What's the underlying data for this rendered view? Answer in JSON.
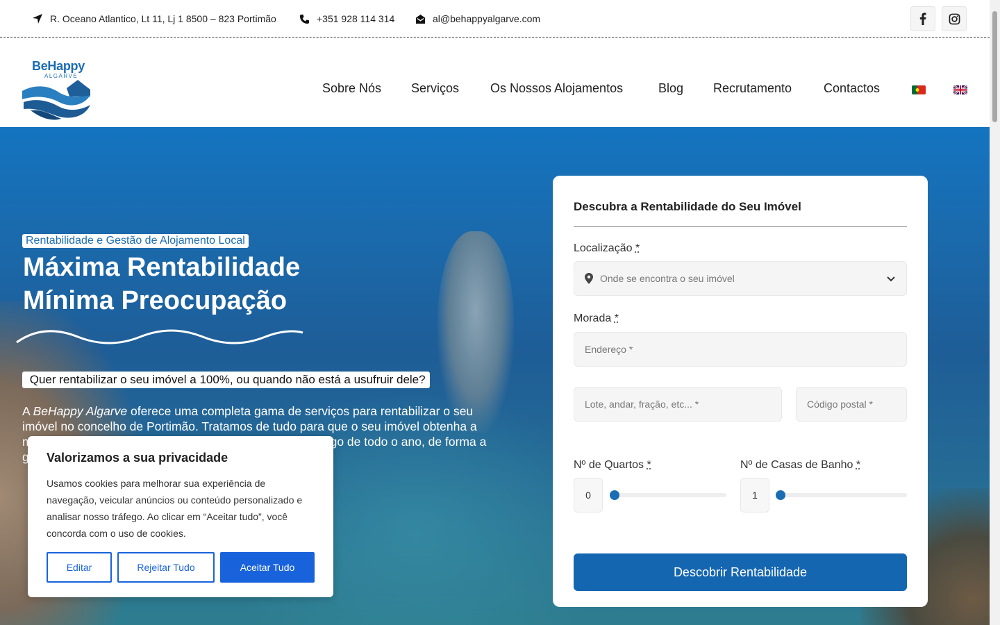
{
  "topbar": {
    "address": "R. Oceano Atlantico, Lt 11, Lj 1 8500 – 823 Portimão",
    "phone": "+351 928 114 314",
    "email": "al@behappyalgarve.com"
  },
  "logo": {
    "brand": "BeHappy",
    "sub": "ALGARVE"
  },
  "nav": {
    "items": [
      "Sobre Nós",
      "Serviços",
      "Os Nossos Alojamentos",
      "Blog",
      "Recrutamento",
      "Contactos"
    ]
  },
  "hero": {
    "tagline": "Rentabilidade e Gestão de Alojamento Local",
    "headline_line1": "Máxima Rentabilidade",
    "headline_line2": "Mínima Preocupação",
    "question": "󠁧󠁢 Quer rentabilizar o seu imóvel a 100%, ou quando não está a usufruir dele?",
    "para_prefix": "A ",
    "para_brand": "BeHappy Algarve",
    "para_text": " oferece uma completa gama de serviços para rentabilizar o seu imóvel no concelho de Portimão. Tratamos de tudo para que o seu imóvel obtenha a máxima rentabilidade, com uma taxa de ocupação ao longo de todo o ano, de forma a garantir o máximo de retorno."
  },
  "form": {
    "title": "Descubra a Rentabilidade do Seu Imóvel",
    "location_label": "Localização",
    "location_placeholder": "Onde se encontra o seu imóvel",
    "address_label": "Morada",
    "address_placeholder": "Endereço *",
    "lot_placeholder": "Lote, andar, fração, etc... *",
    "postal_placeholder": "Código postal *",
    "rooms_label": "Nº de Quartos",
    "rooms_value": "0",
    "baths_label": "Nº de Casas de Banho",
    "baths_value": "1",
    "required_mark": "*",
    "submit_label": "Descobrir Rentabilidade"
  },
  "cookie": {
    "title": "Valorizamos a sua privacidade",
    "description": "Usamos cookies para melhorar sua experiência de navegação, veicular anúncios ou conteúdo personalizado e analisar nosso tráfego. Ao clicar em “Aceitar tudo”, você concorda com o uso de cookies.",
    "edit_label": "Editar",
    "reject_label": "Rejeitar Tudo",
    "accept_label": "Aceitar Tudo"
  },
  "colors": {
    "brand_blue": "#1a6db3",
    "cookie_blue": "#1863dc",
    "submit_blue": "#1566b1"
  },
  "icons": [
    "location-arrow-icon",
    "phone-icon",
    "envelope-icon",
    "facebook-icon",
    "instagram-icon",
    "map-pin-icon",
    "chevron-down-icon",
    "portugal-flag-icon",
    "uk-flag-icon"
  ]
}
